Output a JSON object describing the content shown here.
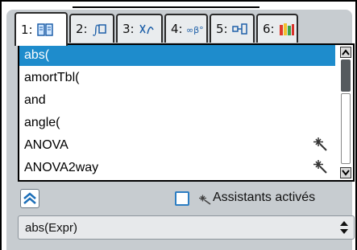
{
  "tabs": [
    {
      "label": "1:",
      "icon": "catalog-book-icon",
      "active": true
    },
    {
      "label": "2:",
      "icon": "math-templates-icon"
    },
    {
      "label": "3:",
      "icon": "symbols-icon"
    },
    {
      "label": "4:",
      "icon": "units-icon"
    },
    {
      "label": "5:",
      "icon": "library-icon"
    },
    {
      "label": "6:",
      "icon": "colors-icon"
    }
  ],
  "list": {
    "items": [
      {
        "label": "abs(",
        "selected": true,
        "wizard": false
      },
      {
        "label": "amortTbl(",
        "selected": false,
        "wizard": false
      },
      {
        "label": "and",
        "selected": false,
        "wizard": false
      },
      {
        "label": "angle(",
        "selected": false,
        "wizard": false
      },
      {
        "label": "ANOVA",
        "selected": false,
        "wizard": true
      },
      {
        "label": "ANOVA2way",
        "selected": false,
        "wizard": true
      }
    ]
  },
  "wizards": {
    "label": "Assistants activés",
    "checked": false
  },
  "syntax": {
    "value": "abs(Expr)"
  },
  "colors": {
    "selection": "#1e8ccc",
    "dialog_bg": "#c7ccd0",
    "checkbox_border": "#2c7dc2"
  }
}
